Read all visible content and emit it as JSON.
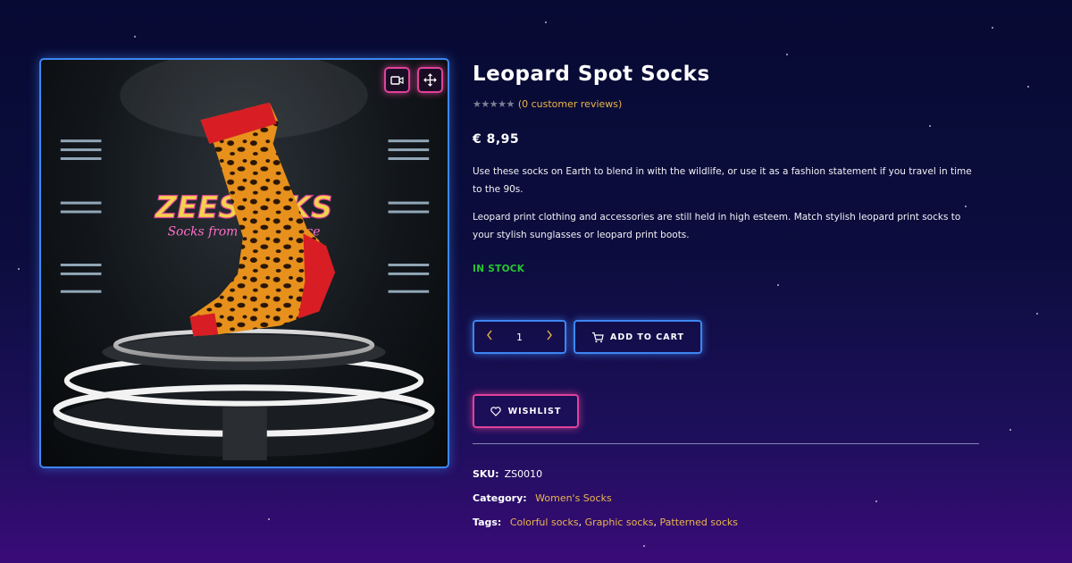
{
  "product": {
    "title": "Leopard Spot Socks",
    "review_text": "(0 customer reviews)",
    "rating_stars": "★★★★★",
    "price": "€ 8,95",
    "description": [
      "Use these socks on Earth to blend in with the wildlife, or use it as a fashion statement if you travel in time to the 90s.",
      "Leopard print clothing and accessories are still held in high esteem. Match stylish leopard print socks to your stylish sunglasses or leopard print boots."
    ],
    "stock_status": "IN STOCK",
    "quantity": "1",
    "add_to_cart_label": "ADD TO CART",
    "wishlist_label": "WISHLIST",
    "sku_label": "SKU:",
    "sku_value": "ZS0010",
    "category_label": "Category:",
    "category_value": "Women's Socks",
    "tags_label": "Tags:",
    "tags": [
      "Colorful socks",
      "Graphic socks",
      "Patterned socks"
    ]
  },
  "gallery": {
    "logo_text": "ZEESOCKS",
    "logo_tagline": "Socks from Outer Space",
    "icons": [
      "video-icon",
      "move-icon"
    ]
  },
  "colors": {
    "background_top": "#070a33",
    "background_bottom": "#3a0b78",
    "accent_blue": "#3d86f2",
    "accent_pink": "#e0429a",
    "link_gold": "#e9b64b",
    "stock_green": "#27c631"
  }
}
